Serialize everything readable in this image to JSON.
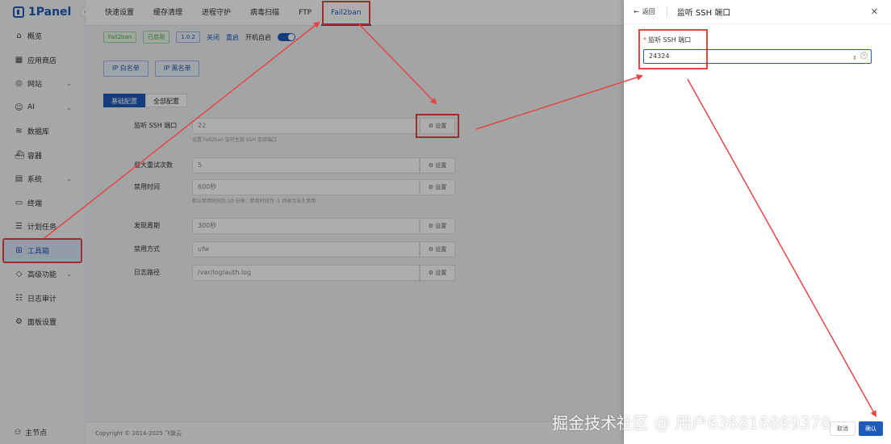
{
  "app": {
    "logo_text": "1Panel",
    "collapse_glyph": "‹"
  },
  "sidebar": {
    "items": [
      {
        "label": "概览",
        "icon": "home-icon",
        "glyph": "⌂"
      },
      {
        "label": "应用商店",
        "icon": "grid-icon",
        "glyph": "▦"
      },
      {
        "label": "网站",
        "icon": "globe-icon",
        "glyph": "◎",
        "chevron": "⌄"
      },
      {
        "label": "AI",
        "icon": "robot-icon",
        "glyph": "☺",
        "chevron": "⌄"
      },
      {
        "label": "数据库",
        "icon": "database-icon",
        "glyph": "≋"
      },
      {
        "label": "容器",
        "icon": "container-icon",
        "glyph": "⛴"
      },
      {
        "label": "系统",
        "icon": "system-icon",
        "glyph": "▤",
        "chevron": "⌄"
      },
      {
        "label": "终端",
        "icon": "terminal-icon",
        "glyph": "▭"
      },
      {
        "label": "计划任务",
        "icon": "calendar-icon",
        "glyph": "☰"
      },
      {
        "label": "工具箱",
        "icon": "toolbox-icon",
        "glyph": "⊞",
        "active": true
      },
      {
        "label": "高级功能",
        "icon": "diamond-icon",
        "glyph": "◇",
        "chevron": "⌄"
      },
      {
        "label": "日志审计",
        "icon": "log-icon",
        "glyph": "☷"
      },
      {
        "label": "面板设置",
        "icon": "settings-icon",
        "glyph": "⚙"
      }
    ],
    "node_label": "主节点",
    "node_glyph": "⚇"
  },
  "tabs": [
    "快速设置",
    "缓存清理",
    "进程守护",
    "病毒扫描",
    "FTP",
    "Fail2ban"
  ],
  "status": {
    "name_tag": "Fail2ban",
    "state_tag": "已启用",
    "version_tag": "1.0.2",
    "stop_label": "关闭",
    "restart_label": "重启",
    "autostart_label": "开机自启"
  },
  "list_buttons": {
    "whitelist": "IP 白名单",
    "blacklist": "IP 黑名单"
  },
  "subtabs": {
    "basic": "基础配置",
    "all": "全部配置"
  },
  "form": {
    "set_label": "设置",
    "set_glyph": "⚙",
    "rows": [
      {
        "label": "监听 SSH 端口",
        "value": "22",
        "help": "设置 Fail2ban 监听生效 SSH 连接端口"
      },
      {
        "label": "最大重试次数",
        "value": "5",
        "help": ""
      },
      {
        "label": "禁用时间",
        "value": "600秒",
        "help": "默认禁用时间为 10 分钟，禁用时间为 -1 则表示永久禁用"
      },
      {
        "label": "发现周期",
        "value": "300秒",
        "help": ""
      },
      {
        "label": "禁用方式",
        "value": "ufw",
        "help": ""
      },
      {
        "label": "日志路径",
        "value": "/var/log/auth.log",
        "help": ""
      }
    ]
  },
  "footer": {
    "copyright": "Copyright © 2014-2025 飞致云"
  },
  "drawer": {
    "back_label": "返回",
    "back_glyph": "←",
    "title": "监听 SSH 端口",
    "close_glyph": "✕",
    "field_required": "*",
    "field_label": "监听 SSH 端口",
    "field_value": "24324",
    "spin_glyph": "⇕",
    "clear_glyph": "×",
    "cancel_label": "取消",
    "confirm_label": "确认"
  },
  "watermark": "掘金技术社区 @ 用户636816869378",
  "colors": {
    "accent": "#1e5ab9",
    "annotation": "#e64545"
  }
}
